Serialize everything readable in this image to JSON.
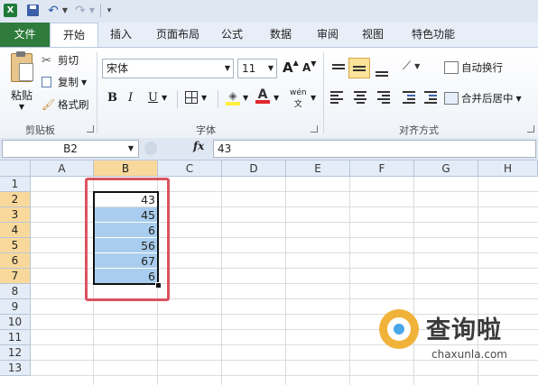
{
  "quick_access": {
    "excel_icon": "excel-icon",
    "save_icon": "save-icon",
    "undo_icon": "undo-icon",
    "redo_icon": "redo-icon",
    "customize_icon": "customize-qat-icon"
  },
  "tabs": [
    "文件",
    "开始",
    "插入",
    "页面布局",
    "公式",
    "数据",
    "审阅",
    "视图",
    "特色功能"
  ],
  "ribbon": {
    "clipboard": {
      "paste_label": "粘贴",
      "cut_label": "剪切",
      "copy_label": "复制",
      "format_painter_label": "格式刷",
      "group_label": "剪贴板"
    },
    "font": {
      "font_name": "宋体",
      "font_size": "11",
      "bold": "B",
      "italic": "I",
      "underline": "U",
      "phonetic": "wén",
      "group_label": "字体",
      "grow_label": "A",
      "shrink_label": "A"
    },
    "alignment": {
      "wrap_text_label": "自动换行",
      "merge_center_label": "合并后居中",
      "group_label": "对齐方式"
    }
  },
  "formula_bar": {
    "name_box": "B2",
    "fx_label": "fx",
    "value": "43"
  },
  "sheet": {
    "columns": [
      "A",
      "B",
      "C",
      "D",
      "E",
      "F",
      "G",
      "H"
    ],
    "rows": [
      "1",
      "2",
      "3",
      "4",
      "5",
      "6",
      "7",
      "8",
      "9",
      "10",
      "11",
      "12",
      "13"
    ],
    "selected_column": "B",
    "selected_rows": [
      "2",
      "3",
      "4",
      "5",
      "6",
      "7"
    ],
    "b_values": [
      "43",
      "45",
      "6",
      "56",
      "67",
      "6"
    ],
    "selection_color": "#a9cdee",
    "highlight_border_color": "#d9535f"
  },
  "watermark": {
    "brand_text": "查询啦",
    "domain_text": "chaxunla.com"
  },
  "colors": {
    "file_tab": "#2f7c3d",
    "header_selected": "#f9d99b"
  }
}
